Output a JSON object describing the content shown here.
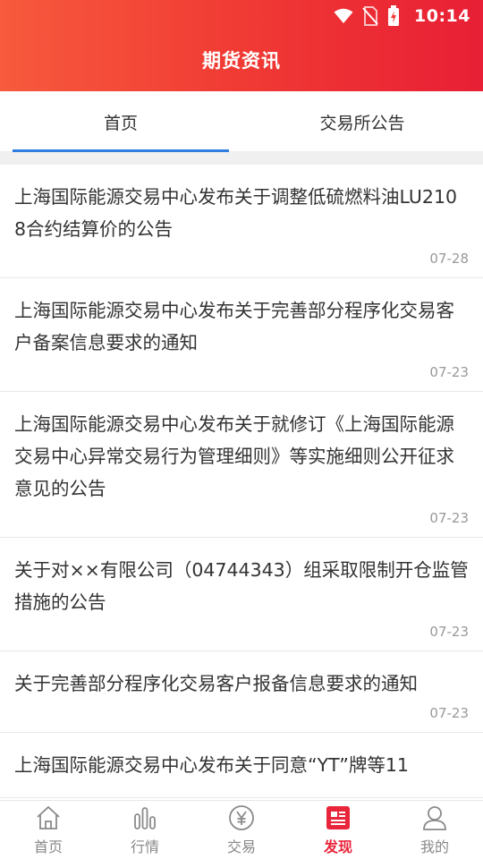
{
  "status_bar": {
    "time": "10:14",
    "icons": [
      "wifi-icon",
      "no-sim-icon",
      "battery-charging-icon"
    ]
  },
  "header": {
    "title": "期货资讯",
    "gradient": [
      "#f75a3d",
      "#e81f35"
    ]
  },
  "tabs": [
    {
      "label": "首页",
      "active": true
    },
    {
      "label": "交易所公告",
      "active": false
    }
  ],
  "accent_color": "#2f7de1",
  "news": [
    {
      "title": "上海国际能源交易中心发布关于调整低硫燃料油LU2108合约结算价的公告",
      "date": "07-28"
    },
    {
      "title": "上海国际能源交易中心发布关于完善部分程序化交易客户备案信息要求的通知",
      "date": "07-23"
    },
    {
      "title": "上海国际能源交易中心发布关于就修订《上海国际能源交易中心异常交易行为管理细则》等实施细则公开征求意见的公告",
      "date": "07-23"
    },
    {
      "title": "关于对××有限公司（04744343）组采取限制开仓监管措施的公告",
      "date": "07-23"
    },
    {
      "title": "关于完善部分程序化交易客户报备信息要求的通知",
      "date": "07-23"
    },
    {
      "title": "上海国际能源交易中心发布关于同意“YT”牌等11",
      "date": ""
    }
  ],
  "bottom_nav": [
    {
      "label": "首页",
      "icon": "home-icon",
      "active": false
    },
    {
      "label": "行情",
      "icon": "chart-bars-icon",
      "active": false
    },
    {
      "label": "交易",
      "icon": "yen-coin-icon",
      "active": false
    },
    {
      "label": "发现",
      "icon": "news-icon",
      "active": true
    },
    {
      "label": "我的",
      "icon": "person-icon",
      "active": false
    }
  ],
  "active_nav_color": "#e8253a"
}
